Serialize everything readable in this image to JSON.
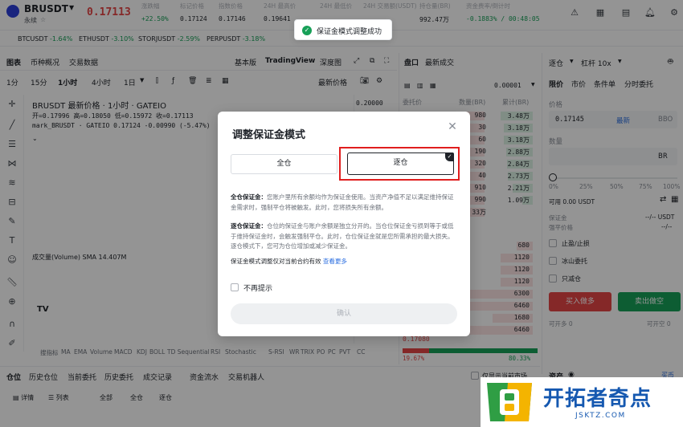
{
  "header": {
    "pair": "BRUSDT",
    "pair_sub": "永续",
    "last_price": "0.17113",
    "stats": [
      {
        "label": "涨跌幅",
        "value": "+22.50%"
      },
      {
        "label": "标记价格",
        "value": "0.17124"
      },
      {
        "label": "指数价格",
        "value": "0.17146"
      },
      {
        "label": "24H 最高价",
        "value": "0.19641"
      },
      {
        "label": "24H 最低价",
        "value": ""
      },
      {
        "label": "24H 交易额(USDT)",
        "value": ""
      },
      {
        "label": "持仓量(BR)",
        "value": "992.47万"
      },
      {
        "label": "资金费率/倒计时",
        "value": "-0.1883% / 00:48:05"
      }
    ]
  },
  "toast": {
    "text": "保证金模式调整成功"
  },
  "tickers": [
    {
      "pair": "BTCUSDT",
      "change": "-1.64%"
    },
    {
      "pair": "ETHUSDT",
      "change": "-3.10%"
    },
    {
      "pair": "STORJUSDT",
      "change": "-2.59%"
    },
    {
      "pair": "PERPUSDT",
      "change": "-3.18%"
    }
  ],
  "chart": {
    "tabs": [
      "图表",
      "币种概况",
      "交易数据"
    ],
    "view_tabs": [
      "基本版",
      "TradingView",
      "深度图"
    ],
    "intervals": [
      "1分",
      "15分",
      "1小时",
      "4小时",
      "1日"
    ],
    "price_type": "最新价格",
    "title": "BRUSDT 最新价格 · 1小时 · GATEIO",
    "ohlc": "开=0.17996  高=0.18050  低=0.15972  收=0.17113",
    "mark_line": "mark_BRUSDT · GATEIO  0.17124  -0.00990 (-5.47%)",
    "volume_label": "成交量(Volume) SMA  14.407M",
    "axis_value": "0.20000",
    "indicators": [
      "搜指标",
      "MA",
      "EMA",
      "Volume",
      "MACD",
      "KDJ",
      "BOLL",
      "TD Sequential",
      "RSI",
      "Stochastic",
      "S-RSI",
      "WR",
      "TRIX",
      "PO",
      "PC",
      "PVT",
      "CC"
    ]
  },
  "orderbook": {
    "tabs": [
      "盘口",
      "最新成交"
    ],
    "precision": "0.00001",
    "headers": [
      "委托价",
      "数量(BR)",
      "累计(BR)"
    ],
    "asks": [
      {
        "size": "980",
        "total": "3.48万"
      },
      {
        "size": "30",
        "total": "3.18万"
      },
      {
        "size": "60",
        "total": "3.18万"
      },
      {
        "size": "190",
        "total": "2.88万"
      },
      {
        "size": "320",
        "total": "2.84万"
      },
      {
        "size": "40",
        "total": "2.73万"
      },
      {
        "size": "910",
        "total": "2.21万"
      },
      {
        "size": "990",
        "total": "1.09万"
      },
      {
        "size": "33万",
        "total": ""
      }
    ],
    "mid": "24",
    "bids": [
      {
        "size": "680"
      },
      {
        "size": "1120"
      },
      {
        "size": "1120"
      },
      {
        "size": "1120"
      },
      {
        "size": "6300"
      },
      {
        "size": "6460"
      },
      {
        "size": "1680"
      },
      {
        "size": "6460"
      }
    ],
    "last_bid_price": "0.17080",
    "buy_ratio": "19.67%",
    "sell_ratio": "80.33%"
  },
  "trade": {
    "mode": "逐仓",
    "leverage": "杠杆 10x",
    "order_types": [
      "限价",
      "市价",
      "条件单",
      "分时委托"
    ],
    "price_label": "价格",
    "price_value": "0.17145",
    "latest": "最新",
    "price_unit": "BBO",
    "qty_label": "数量",
    "qty_unit": "BR",
    "slider_marks": [
      "0%",
      "25%",
      "50%",
      "75%",
      "100%"
    ],
    "available": "可用  0.00 USDT",
    "margin_label": "保证金",
    "margin_value": "--/-- USDT",
    "liq_label": "强平价格",
    "liq_value": "--/--",
    "options": [
      "止盈/止损",
      "冰山委托",
      "只减仓"
    ],
    "buy": "买入做多",
    "sell": "卖出做空",
    "can_open_left": "可开多  0",
    "can_open_right": "可开空  0",
    "assets": "资产",
    "buy_link": "买币"
  },
  "bottom": {
    "tabs": [
      "仓位",
      "历史仓位",
      "当前委托",
      "历史委托",
      "成交记录",
      "资金流水",
      "交易机器人"
    ],
    "sub_tabs": [
      "详情",
      "列表",
      "全部",
      "全仓",
      "逐仓"
    ],
    "current_only": "仅显示当前市场"
  },
  "modal": {
    "title": "调整保证金模式",
    "cross": "全仓",
    "isolated": "逐仓",
    "cross_title": "全仓保证金：",
    "cross_desc": "您账户里所有余额均作为保证金使用。当资产净值不足以满足维持保证金需求时，强制平仓将被触发。此时，您将损失所有余额。",
    "isolated_title": "逐仓保证金：",
    "isolated_desc": "仓位的保证金与账户余额是独立分开的。当仓位保证金亏损到等于或低于维持保证金时，会触发强制平仓。此时，仓位保证金就是您所需承担的最大损失。逐仓模式下，您可为仓位增加或减少保证金。",
    "apply_note": "保证金模式调整仅对当前合约有效",
    "learn_more": "查看更多",
    "dont_show": "不再提示",
    "confirm": "确认"
  },
  "watermark": {
    "name": "开拓者奇点",
    "url": "JSKTZ.COM"
  },
  "colors": {
    "up": "#18a058",
    "down": "#e64545",
    "accent": "#2c6fe0",
    "highlight": "#e01e1e"
  }
}
